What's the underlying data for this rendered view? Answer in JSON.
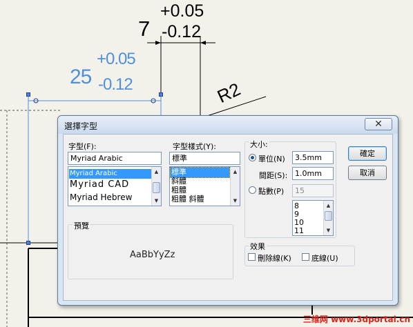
{
  "cad": {
    "dim_top_base": "7",
    "dim_top_upper": "+0.05",
    "dim_top_lower": "-0.12",
    "dim_left_base": "25",
    "dim_left_upper": "+0.05",
    "dim_left_lower": "-0.12",
    "radius_label": "R2"
  },
  "dialog": {
    "title": "選擇字型",
    "close_symbol": "✕",
    "font_label": "字型(F):",
    "font_value": "Myriad Arabic",
    "font_list": [
      "Myriad Arabic",
      "Myriad CAD",
      "Myriad Hebrew"
    ],
    "style_label": "字型樣式(Y):",
    "style_value": "標準",
    "style_list": [
      "標準",
      "斜體",
      "粗體",
      "粗體 斜體"
    ],
    "size_group_label": "大小:",
    "unit_radio_label": "單位(N)",
    "unit_value": "3.5mm",
    "spacing_label": "間距(S):",
    "spacing_value": "1.0mm",
    "points_radio_label": "點數(P)",
    "points_value": "15",
    "points_list": [
      "8",
      "9",
      "10",
      "11"
    ],
    "preview_label": "預覽",
    "preview_text": "AaBbYyZz",
    "effects_label": "效果",
    "strikeout_label": "刪除線(K)",
    "underline_label": "底線(U)",
    "ok_label": "確定",
    "cancel_label": "取消"
  },
  "watermark": "三维网 www.3dportal.cn",
  "colors": {
    "canvas": "#f3f2ea",
    "dimension_blue": "#4f8fe0",
    "selection": "#3399ff",
    "watermark_red": "#e0241b"
  }
}
